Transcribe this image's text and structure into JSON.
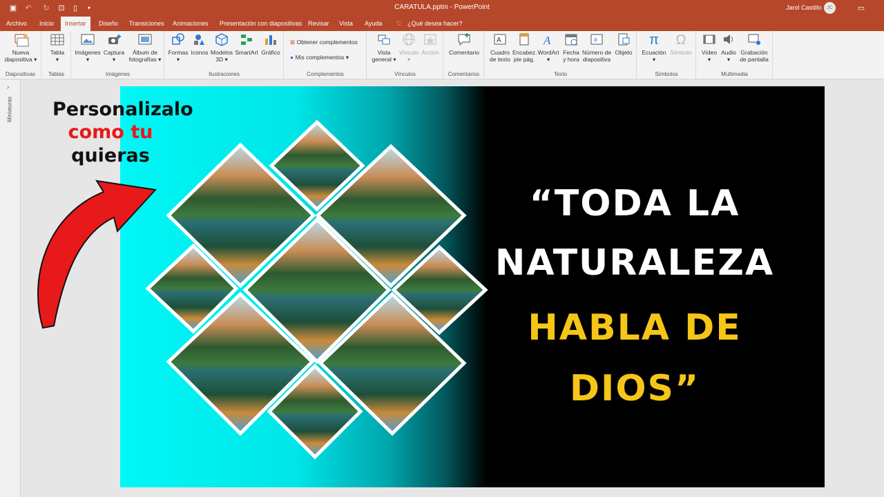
{
  "window": {
    "doc_title": "CARATULA.pptm  -  PowerPoint",
    "user": "Jarol Castillo",
    "user_initials": "JC"
  },
  "tabs": [
    "Archivo",
    "Inicio",
    "Insertar",
    "Diseño",
    "Transiciones",
    "Animaciones",
    "Presentación con diapositivas",
    "Revisar",
    "Vista",
    "Ayuda",
    "¿Qué desea hacer?"
  ],
  "ribbon": {
    "diapositivas": {
      "label": "Diapositivas",
      "new_slide": "Nueva",
      "new_slide2": "diapositiva"
    },
    "tablas": {
      "label": "Tablas",
      "table": "Tabla"
    },
    "imagenes": {
      "label": "Imágenes",
      "images": "Imágenes",
      "capture": "Captura",
      "album": "Álbum de",
      "album2": "fotografías"
    },
    "ilustraciones": {
      "label": "Ilustraciones",
      "shapes": "Formas",
      "icons": "Iconos",
      "models": "Modelos",
      "models2": "3D",
      "smartart": "SmartArt",
      "chart": "Gráfico"
    },
    "complementos": {
      "label": "Complementos",
      "get": "Obtener complementos",
      "mine": "Mis complementos"
    },
    "vinculos": {
      "label": "Vínculos",
      "zoom": "Vista",
      "zoom2": "general",
      "link": "Vínculo",
      "action": "Acción"
    },
    "comentarios": {
      "label": "Comentarios",
      "comment": "Comentario"
    },
    "texto": {
      "label": "Texto",
      "textbox": "Cuadro",
      "textbox2": "de texto",
      "header": "Encabez.",
      "header2": "pie pág.",
      "wordart": "WordArt",
      "date": "Fecha",
      "date2": "y hora",
      "slidenum": "Número de",
      "slidenum2": "diapositiva",
      "object": "Objeto"
    },
    "simbolos": {
      "label": "Símbolos",
      "equation": "Ecuación",
      "symbol": "Símbolo"
    },
    "multimedia": {
      "label": "Multimedia",
      "video": "Vídeo",
      "audio": "Audio",
      "record": "Grabación",
      "record2": "de pantalla"
    }
  },
  "thumbnails_label": "Miniaturas",
  "overlay": {
    "line1": "Personalizalo",
    "line2": "como tu",
    "line3": "quieras"
  },
  "slide": {
    "quote1": "“TODA LA",
    "quote2": "NATURALEZA",
    "quote3": "HABLA DE",
    "quote4": "DIOS”"
  },
  "colors": {
    "accent": "#b7472a",
    "quote_white": "#ffffff",
    "quote_gold": "#f5c518",
    "overlay_red": "#e8191a"
  }
}
